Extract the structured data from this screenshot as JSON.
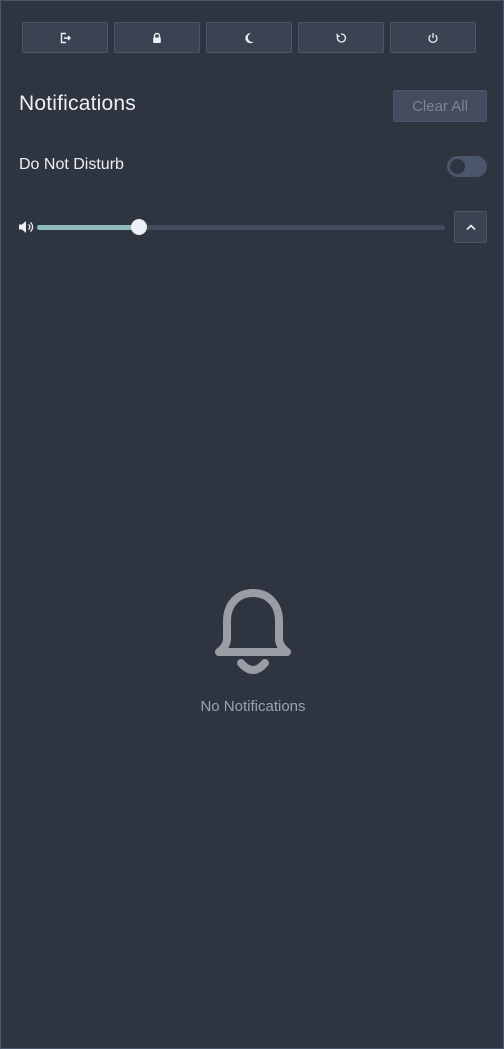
{
  "power_buttons": [
    {
      "name": "logout",
      "icon": "logout-icon"
    },
    {
      "name": "lock",
      "icon": "lock-icon"
    },
    {
      "name": "sleep",
      "icon": "moon-icon"
    },
    {
      "name": "reboot",
      "icon": "restart-icon"
    },
    {
      "name": "shutdown",
      "icon": "power-icon"
    }
  ],
  "header": {
    "title": "Notifications",
    "clear_label": "Clear All"
  },
  "dnd": {
    "label": "Do Not Disturb",
    "enabled": false
  },
  "volume": {
    "level": 0.25,
    "icon": "speaker-icon"
  },
  "expand": {
    "icon": "chevron-up-icon"
  },
  "empty_state": {
    "icon": "bell-icon",
    "text": "No Notifications"
  },
  "colors": {
    "background": "#2e3440",
    "accent": "#8fbcbb",
    "muted_text": "#9ba1ad"
  }
}
